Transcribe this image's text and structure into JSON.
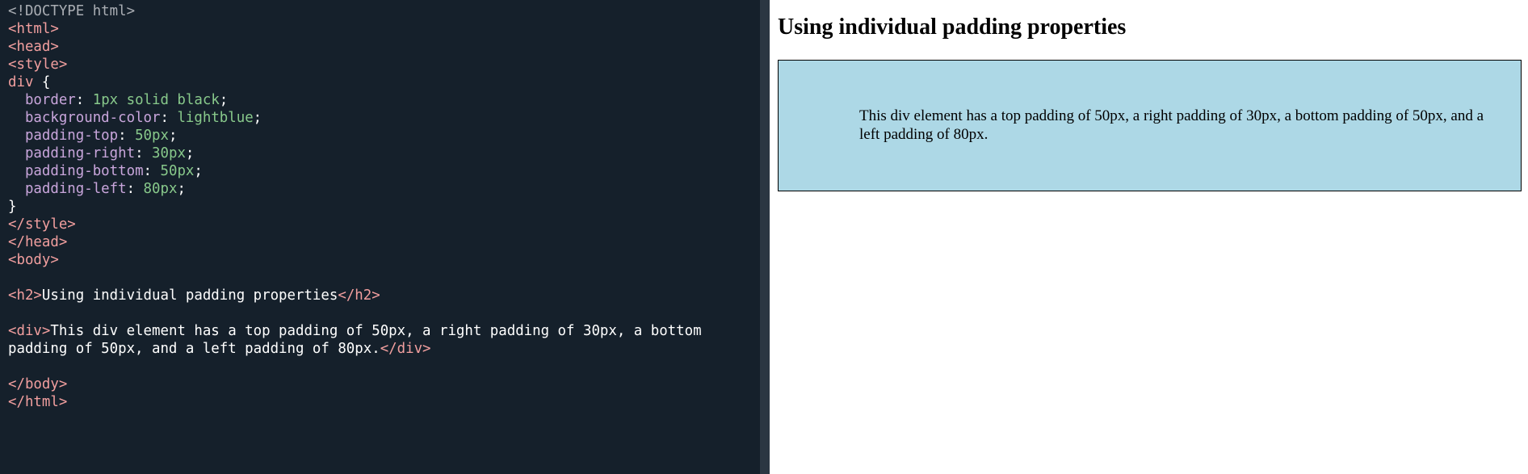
{
  "editor": {
    "lines": [
      [
        {
          "t": "doctype",
          "v": "<!DOCTYPE html>"
        }
      ],
      [
        {
          "t": "tag",
          "v": "<html>"
        }
      ],
      [
        {
          "t": "tag",
          "v": "<head>"
        }
      ],
      [
        {
          "t": "tag",
          "v": "<style>"
        }
      ],
      [
        {
          "t": "sel",
          "v": "div"
        },
        {
          "t": "text",
          "v": " {"
        }
      ],
      [
        {
          "t": "text",
          "v": "  "
        },
        {
          "t": "prop",
          "v": "border"
        },
        {
          "t": "text",
          "v": ": "
        },
        {
          "t": "val",
          "v": "1px solid black"
        },
        {
          "t": "text",
          "v": ";"
        }
      ],
      [
        {
          "t": "text",
          "v": "  "
        },
        {
          "t": "prop",
          "v": "background-color"
        },
        {
          "t": "text",
          "v": ": "
        },
        {
          "t": "val",
          "v": "lightblue"
        },
        {
          "t": "text",
          "v": ";"
        }
      ],
      [
        {
          "t": "text",
          "v": "  "
        },
        {
          "t": "prop",
          "v": "padding-top"
        },
        {
          "t": "text",
          "v": ": "
        },
        {
          "t": "val",
          "v": "50px"
        },
        {
          "t": "text",
          "v": ";"
        }
      ],
      [
        {
          "t": "text",
          "v": "  "
        },
        {
          "t": "prop",
          "v": "padding-right"
        },
        {
          "t": "text",
          "v": ": "
        },
        {
          "t": "val",
          "v": "30px"
        },
        {
          "t": "text",
          "v": ";"
        }
      ],
      [
        {
          "t": "text",
          "v": "  "
        },
        {
          "t": "prop",
          "v": "padding-bottom"
        },
        {
          "t": "text",
          "v": ": "
        },
        {
          "t": "val",
          "v": "50px"
        },
        {
          "t": "text",
          "v": ";"
        }
      ],
      [
        {
          "t": "text",
          "v": "  "
        },
        {
          "t": "prop",
          "v": "padding-left"
        },
        {
          "t": "text",
          "v": ": "
        },
        {
          "t": "val",
          "v": "80px"
        },
        {
          "t": "text",
          "v": ";"
        }
      ],
      [
        {
          "t": "text",
          "v": "}"
        }
      ],
      [
        {
          "t": "tag",
          "v": "</style>"
        }
      ],
      [
        {
          "t": "tag",
          "v": "</head>"
        }
      ],
      [
        {
          "t": "tag",
          "v": "<body>"
        }
      ],
      [],
      [
        {
          "t": "tag",
          "v": "<h2>"
        },
        {
          "t": "text",
          "v": "Using individual padding properties"
        },
        {
          "t": "tag",
          "v": "</h2>"
        }
      ],
      [],
      [
        {
          "t": "tag",
          "v": "<div>"
        },
        {
          "t": "text",
          "v": "This div element has a top padding of 50px, a right padding of 30px, a bottom"
        }
      ],
      [
        {
          "t": "text",
          "v": "padding of 50px, and a left padding of 80px."
        },
        {
          "t": "tag",
          "v": "</div>"
        }
      ],
      [],
      [
        {
          "t": "tag",
          "v": "</body>"
        }
      ],
      [
        {
          "t": "tag",
          "v": "</html>"
        }
      ]
    ]
  },
  "result": {
    "heading": "Using individual padding properties",
    "div_text": "This div element has a top padding of 50px, a right padding of 30px, a bottom padding of 50px, and a left padding of 80px."
  },
  "colors": {
    "editor_background": "#15202b",
    "tag": "#f29f9f",
    "property": "#c9a6dc",
    "value": "#88c98b",
    "doctype": "#a9adb3",
    "div_background": "#add8e6"
  }
}
